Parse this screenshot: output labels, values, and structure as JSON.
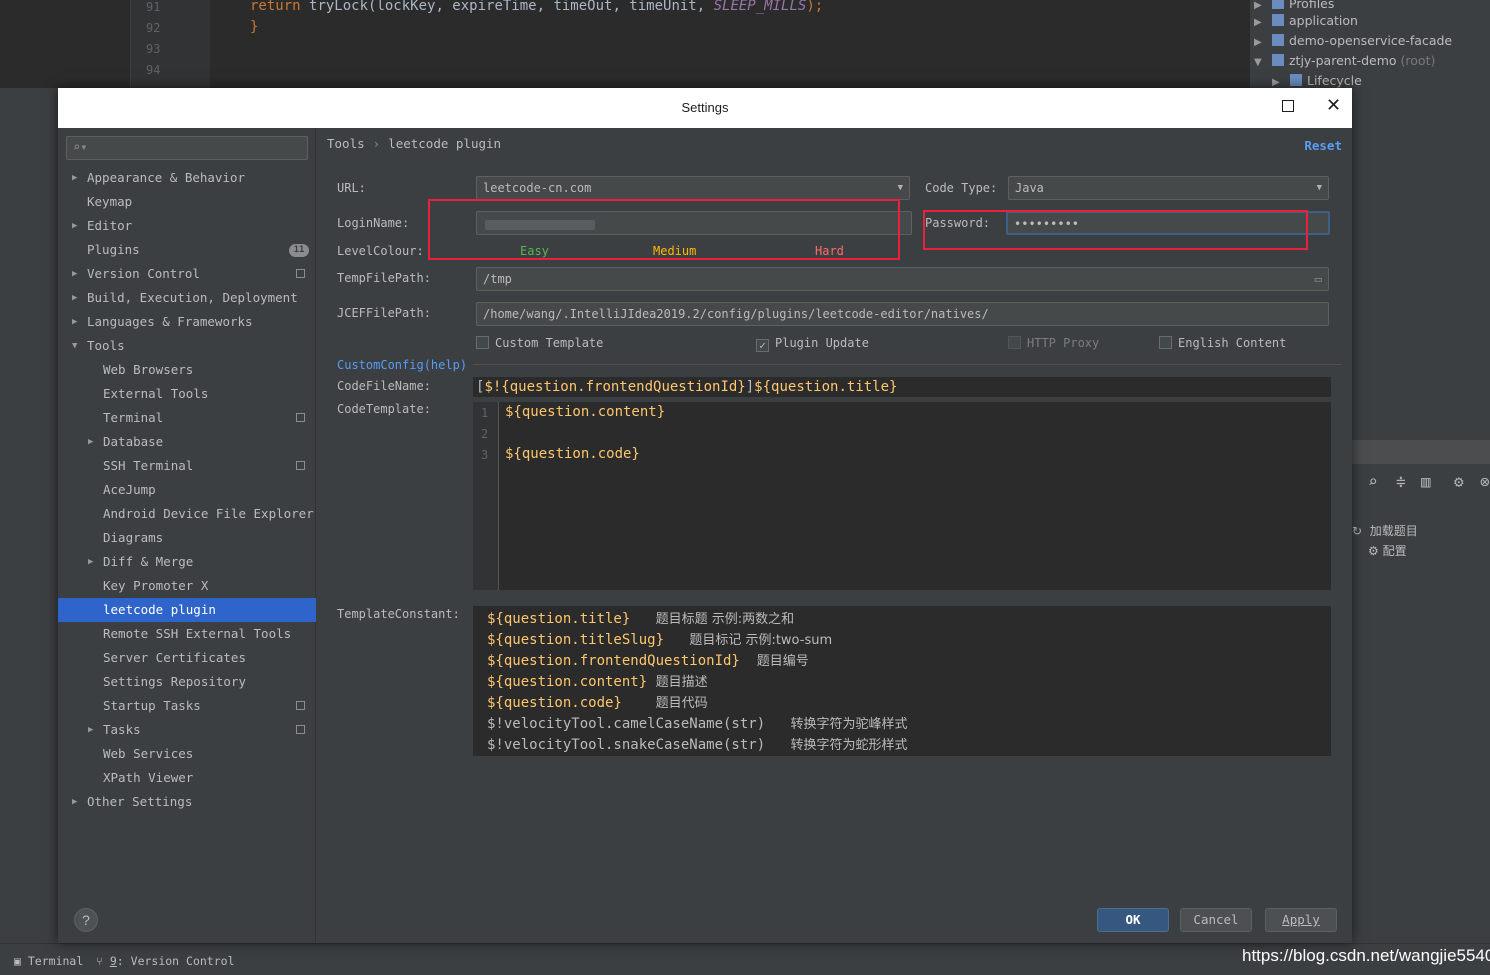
{
  "background": {
    "editor_lines": [
      "91",
      "92",
      "93",
      "94"
    ],
    "code_line_return": "return",
    "code_line_call": "tryLock(lockKey, expireTime, timeOut, timeUnit, ",
    "code_line_const": "SLEEP_MILLS",
    "code_line_end": ");",
    "code_brace": "}",
    "project_tree": [
      {
        "label": "Profiles",
        "suffix": ""
      },
      {
        "label": "application",
        "suffix": ""
      },
      {
        "label": "demo-openservice-facade",
        "suffix": ""
      },
      {
        "label": "ztjy-parent-demo",
        "suffix": "(root)"
      },
      {
        "label": "Lifecycle",
        "suffix": ""
      }
    ],
    "tool_items": [
      "加载题目",
      "配置"
    ],
    "status_terminal": "Terminal",
    "status_vcs_num": "9",
    "status_vcs": "Version Control",
    "watermark": "https://blog.csdn.net/wangjie5540"
  },
  "dialog": {
    "title": "Settings",
    "search": {
      "placeholder": ""
    },
    "nav": [
      {
        "label": "Appearance & Behavior"
      },
      {
        "label": "Keymap"
      },
      {
        "label": "Editor"
      },
      {
        "label": "Plugins",
        "badge": "11"
      },
      {
        "label": "Version Control"
      },
      {
        "label": "Build, Execution, Deployment"
      },
      {
        "label": "Languages & Frameworks"
      },
      {
        "label": "Tools"
      },
      {
        "label": "Web Browsers"
      },
      {
        "label": "External Tools"
      },
      {
        "label": "Terminal"
      },
      {
        "label": "Database"
      },
      {
        "label": "SSH Terminal"
      },
      {
        "label": "AceJump"
      },
      {
        "label": "Android Device File Explorer"
      },
      {
        "label": "Diagrams"
      },
      {
        "label": "Diff & Merge"
      },
      {
        "label": "Key Promoter X"
      },
      {
        "label": "leetcode plugin"
      },
      {
        "label": "Remote SSH External Tools"
      },
      {
        "label": "Server Certificates"
      },
      {
        "label": "Settings Repository"
      },
      {
        "label": "Startup Tasks"
      },
      {
        "label": "Tasks"
      },
      {
        "label": "Web Services"
      },
      {
        "label": "XPath Viewer"
      },
      {
        "label": "Other Settings"
      }
    ],
    "breadcrumb": {
      "parent": "Tools",
      "sep": "›",
      "current": "leetcode plugin"
    },
    "reset": "Reset",
    "form": {
      "url_label": "URL:",
      "url_value": "leetcode-cn.com",
      "code_type_label": "Code Type:",
      "code_type_value": "Java",
      "login_label": "LoginName:",
      "password_label": "Password:",
      "password_value": "•••••••••",
      "level_label": "LevelColour:",
      "level_easy": "Easy",
      "level_medium": "Medium",
      "level_hard": "Hard",
      "temp_label": "TempFilePath:",
      "temp_value": "/tmp",
      "jcef_label": "JCEFFilePath:",
      "jcef_value": "/home/wang/.IntelliJIdea2019.2/config/plugins/leetcode-editor/natives/",
      "chk_custom": "Custom Template",
      "chk_plugin_update": "Plugin Update",
      "chk_http_proxy": "HTTP Proxy",
      "chk_english": "English Content",
      "customconfig": "CustomConfig(help)",
      "codefilename_label": "CodeFileName:",
      "codefilename": {
        "p1": "[",
        "p2": "$!{question.frontendQuestionId}",
        "p3": "]",
        "p4": "${question.title}"
      },
      "codetemplate_label": "CodeTemplate:",
      "codetemplate_lines": [
        "1",
        "2",
        "3"
      ],
      "codetemplate_code": [
        "${question.content}",
        "",
        "${question.code}"
      ],
      "templateconstant_label": "TemplateConstant:",
      "constants": [
        {
          "var": "${question.title}",
          "desc": "题目标题 示例:两数之和"
        },
        {
          "var": "${question.titleSlug}",
          "desc": "题目标记 示例:two-sum"
        },
        {
          "var": "${question.frontendQuestionId}",
          "desc": "题目编号"
        },
        {
          "var": "${question.content}",
          "desc": "题目描述"
        },
        {
          "var": "${question.code}",
          "desc": "题目代码"
        },
        {
          "var": "$!velocityTool.camelCaseName(str)",
          "desc": "转换字符为驼峰样式"
        },
        {
          "var": "$!velocityTool.snakeCaseName(str)",
          "desc": "转换字符为蛇形样式"
        }
      ]
    },
    "buttons": {
      "help": "?",
      "ok": "OK",
      "cancel": "Cancel",
      "apply": "Apply"
    }
  },
  "colors": {
    "accent": "#2f65ca",
    "link": "#589df6",
    "easy": "#5ab350",
    "medium": "#ffb800",
    "hard": "#ff6b6b",
    "highlight_box": "#e8213c"
  }
}
